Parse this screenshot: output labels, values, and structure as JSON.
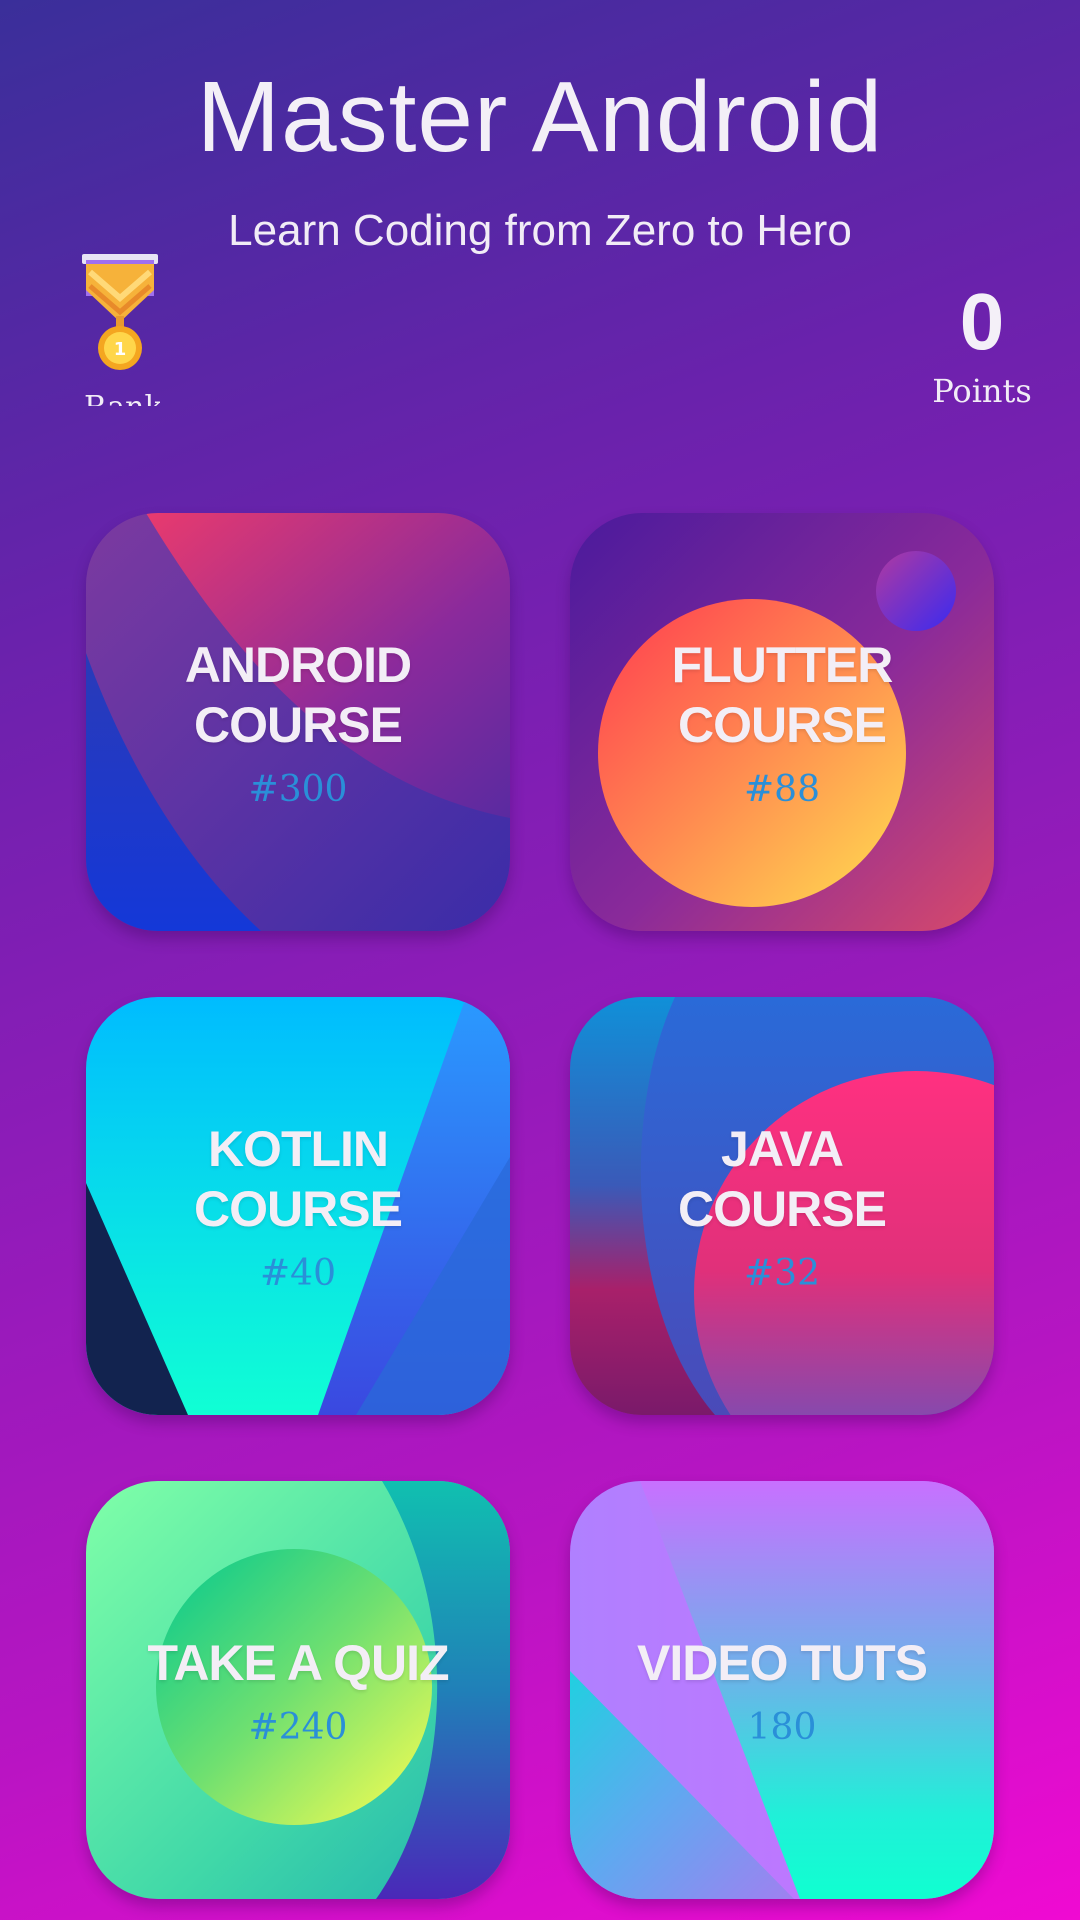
{
  "header": {
    "title": "Master Android",
    "subtitle": "Learn Coding from Zero to Hero"
  },
  "rank": {
    "label": "Rank",
    "icon": "medal-icon"
  },
  "points": {
    "value": "0",
    "label": "Points"
  },
  "cards": [
    {
      "id": "android",
      "title_line1": "ANDROID",
      "title_line2": "COURSE",
      "count": "#300"
    },
    {
      "id": "flutter",
      "title_line1": "FLUTTER",
      "title_line2": "COURSE",
      "count": "#88"
    },
    {
      "id": "kotlin",
      "title_line1": "KOTLIN",
      "title_line2": "COURSE",
      "count": "#40"
    },
    {
      "id": "java",
      "title_line1": "JAVA",
      "title_line2": "COURSE",
      "count": "#32"
    },
    {
      "id": "quiz",
      "title_line1": "TAKE A QUIZ",
      "title_line2": "",
      "count": "#240"
    },
    {
      "id": "video",
      "title_line1": "VIDEO TUTS",
      "title_line2": "",
      "count": "180"
    }
  ],
  "colors": {
    "count_text": "#2a8fd8",
    "background_top": "#3a2f9a",
    "background_bottom": "#f00ad2"
  }
}
